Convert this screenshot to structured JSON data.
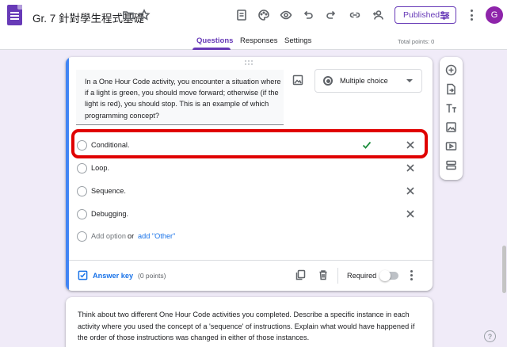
{
  "header": {
    "doc_title": "Gr. 7 針對學生程式基礎",
    "published_label": "Published",
    "avatar_letter": "G"
  },
  "tabs": [
    {
      "label": "Questions",
      "active": true
    },
    {
      "label": "Responses",
      "active": false
    },
    {
      "label": "Settings",
      "active": false
    }
  ],
  "total_points": "Total points: 0",
  "question": {
    "text": "In a One Hour Code activity, you encounter a situation where if a light is green, you should move forward; otherwise (if the light is red), you should stop. This is an example of which programming concept?",
    "type_label": "Multiple choice",
    "options": [
      {
        "label": "Conditional.",
        "correct": true
      },
      {
        "label": "Loop.",
        "correct": false
      },
      {
        "label": "Sequence.",
        "correct": false
      },
      {
        "label": "Debugging.",
        "correct": false
      }
    ],
    "add_option_label": "Add option",
    "or_label": "or",
    "add_other_label": "add \"Other\"",
    "answer_key_label": "Answer key",
    "points_label": "(0 points)",
    "required_label": "Required"
  },
  "question2": {
    "text": "Think about two different One Hour Code activities you completed. Describe a specific instance in each activity where you used the concept of a 'sequence' of instructions. Explain what would have happened if the order of those instructions was changed in either of those instances."
  },
  "colors": {
    "accent": "#673ab7",
    "focus_bar": "#4285f4",
    "highlight_box": "#e00000",
    "correct_check": "#1e8e3e"
  },
  "icons": [
    "folder-icon",
    "star-icon",
    "customize-icon",
    "palette-icon",
    "preview-icon",
    "undo-icon",
    "redo-icon",
    "link-icon",
    "add-collaborator-icon",
    "settings-sliders-icon",
    "more-vert-icon",
    "add-question-icon",
    "import-icon",
    "title-icon",
    "image-icon",
    "video-icon",
    "section-icon",
    "help-icon"
  ]
}
